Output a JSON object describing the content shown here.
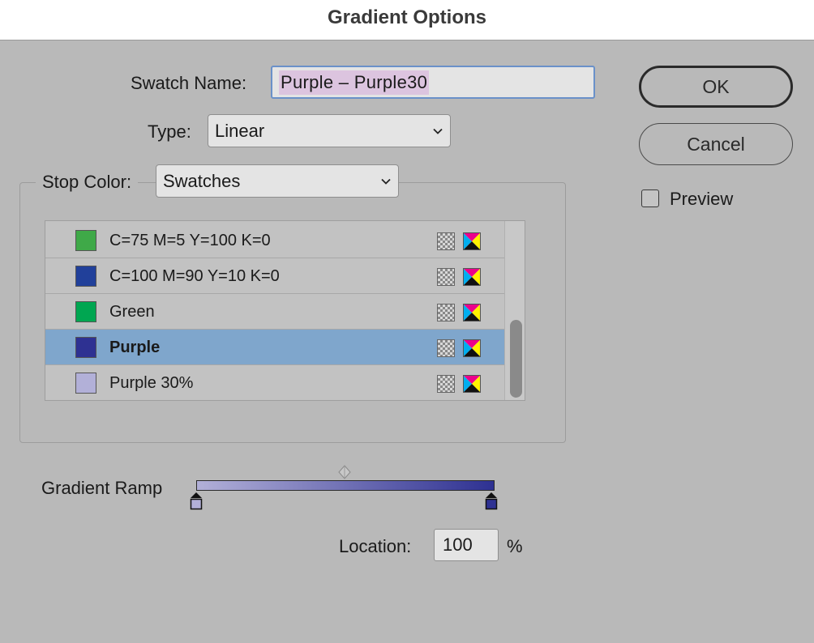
{
  "window": {
    "title": "Gradient Options"
  },
  "swatch_name": {
    "label": "Swatch Name:",
    "value": "Purple – Purple30"
  },
  "type": {
    "label": "Type:",
    "value": "Linear"
  },
  "stop_color": {
    "label": "Stop Color:",
    "value": "Swatches"
  },
  "swatches": [
    {
      "name": "C=75 M=5 Y=100 K=0",
      "color": "#3fa948",
      "selected": false
    },
    {
      "name": "C=100 M=90 Y=10 K=0",
      "color": "#21409a",
      "selected": false
    },
    {
      "name": "Green",
      "color": "#00a651",
      "selected": false
    },
    {
      "name": "Purple",
      "color": "#2e3192",
      "selected": true
    },
    {
      "name": "Purple 30%",
      "color": "#b2b0d8",
      "selected": false
    }
  ],
  "buttons": {
    "ok": "OK",
    "cancel": "Cancel"
  },
  "preview": {
    "label": "Preview",
    "checked": false
  },
  "gradient_ramp": {
    "label": "Gradient Ramp",
    "start_color": "#b2b0d8",
    "end_color": "#2e3192"
  },
  "location": {
    "label": "Location:",
    "value": "100",
    "unit": "%"
  }
}
